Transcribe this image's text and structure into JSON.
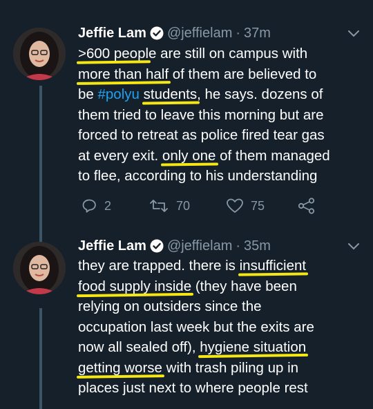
{
  "tweets": [
    {
      "name": "Jeffie Lam",
      "handle": "@jeffielam",
      "separator": "·",
      "time": "37m",
      "lines": [
        [
          {
            "t": ">600 peopl",
            "hl": true
          },
          {
            "t": "e are still on campus with"
          }
        ],
        [
          {
            "t": "more than half",
            "hl": true
          },
          {
            "t": " of them are believed to"
          }
        ],
        [
          {
            "t": "be "
          },
          {
            "t": "#polyu",
            "tag": true
          },
          {
            "t": " "
          },
          {
            "t": "students",
            "hl": true
          },
          {
            "t": ", he says. dozens of"
          }
        ],
        [
          {
            "t": "them tried to leave this morning but are"
          }
        ],
        [
          {
            "t": "forced to retreat as police fired tear gas"
          }
        ],
        [
          {
            "t": "at every exit. "
          },
          {
            "t": "only one",
            "hl": true
          },
          {
            "t": " of them managed"
          }
        ],
        [
          {
            "t": "to flee, according to his understanding"
          }
        ]
      ],
      "replies": "2",
      "retweets": "70",
      "likes": "75"
    },
    {
      "name": "Jeffie Lam",
      "handle": "@jeffielam",
      "separator": "·",
      "time": "35m",
      "lines": [
        [
          {
            "t": "they are trapped. there is "
          },
          {
            "t": "insufficient",
            "hl": true
          }
        ],
        [
          {
            "t": "food supply inside",
            "hl": true
          },
          {
            "t": " (they have been"
          }
        ],
        [
          {
            "t": "relying on outsiders since the"
          }
        ],
        [
          {
            "t": "occupation last week but the exits are"
          }
        ],
        [
          {
            "t": "now all sealed off), "
          },
          {
            "t": "hygiene situation",
            "hl": true
          }
        ],
        [
          {
            "t": "getting worse",
            "hl": true
          },
          {
            "t": " with trash piling up in"
          }
        ],
        [
          {
            "t": "places just next to where people rest"
          }
        ]
      ]
    }
  ],
  "icons": {
    "verified": "verified-badge-icon",
    "menu": "chevron-down-icon",
    "reply": "reply-icon",
    "retweet": "retweet-icon",
    "like": "heart-icon",
    "share": "share-icon"
  },
  "colors": {
    "background": "#15202b",
    "muted": "#8899a6",
    "hashtag": "#1da1f2",
    "highlight": "#f5e716",
    "thread_line": "#3d5466"
  }
}
